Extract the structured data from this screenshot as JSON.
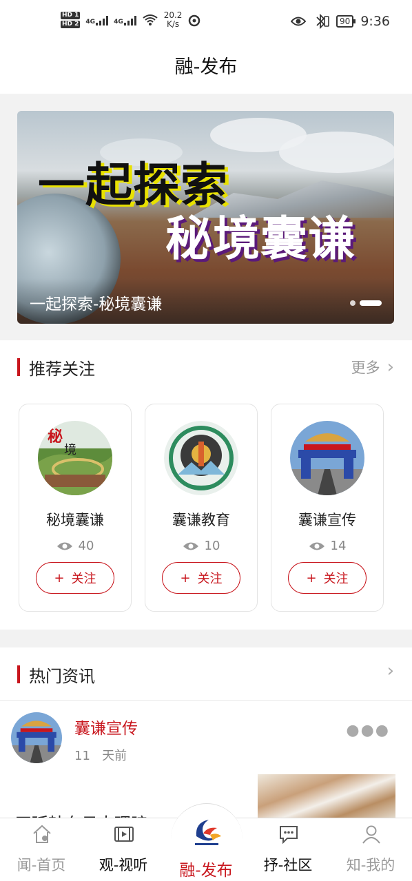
{
  "status_bar": {
    "hd1": "HD 1",
    "hd2": "HD 2",
    "net1": "4G",
    "net2": "4G",
    "speed_value": "20.2",
    "speed_unit": "K/s",
    "battery": "90",
    "time": "9:36"
  },
  "header": {
    "title": "融-发布"
  },
  "banner": {
    "headline_1": "一起探索",
    "headline_2": "秘境囊谦",
    "caption": "一起探索-秘境囊谦",
    "slide_count": 2,
    "active_slide": 2
  },
  "recommended": {
    "title": "推荐关注",
    "more_label": "更多",
    "follow_label": "关注",
    "follow_plus": "+",
    "accounts": [
      {
        "name": "秘境囊谦",
        "views": "40",
        "avatar_icon": "landscape-logo"
      },
      {
        "name": "囊谦教育",
        "views": "10",
        "avatar_icon": "tibetan-emblem"
      },
      {
        "name": "囊谦宣传",
        "views": "14",
        "avatar_icon": "gate-photo"
      }
    ]
  },
  "hot_news": {
    "title": "热门资讯",
    "item": {
      "author": "囊谦宣传",
      "time_value": "11",
      "time_unit": "天前",
      "more_icon": "more-dots-icon",
      "text_partial": "四延韩东日大理暗"
    }
  },
  "bottom_nav": {
    "items": [
      {
        "label": "闻-首页",
        "icon": "home-icon",
        "state": "inactive"
      },
      {
        "label": "观-视听",
        "icon": "film-icon",
        "state": "dark"
      },
      {
        "label": "融-发布",
        "icon": "brand-logo-icon",
        "state": "active"
      },
      {
        "label": "抒-社区",
        "icon": "chat-icon",
        "state": "dark"
      },
      {
        "label": "知-我的",
        "icon": "user-icon",
        "state": "inactive"
      }
    ]
  },
  "colors": {
    "accent": "#c8161d",
    "muted": "#999999",
    "background": "#f2f2f2"
  }
}
